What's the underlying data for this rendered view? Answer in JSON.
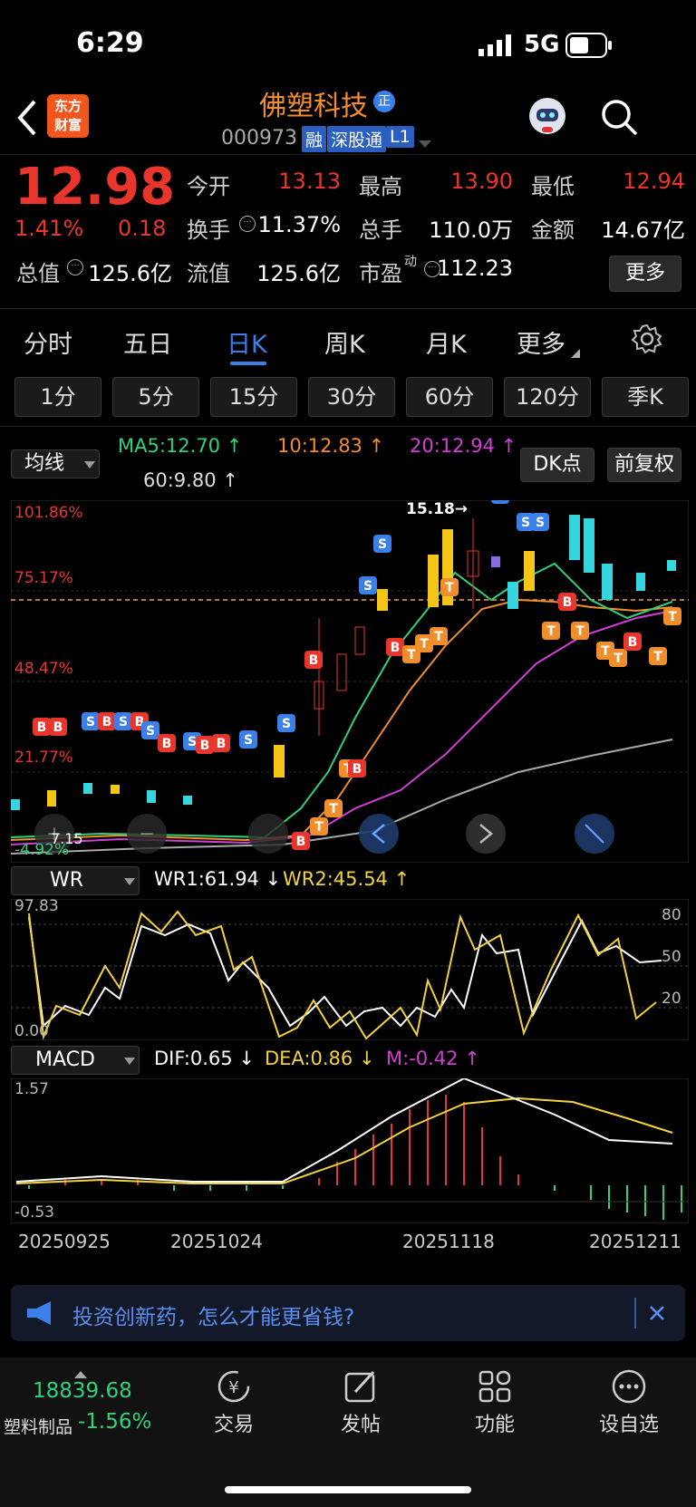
{
  "status_bar": {
    "time": "6:29",
    "network": "5G"
  },
  "header": {
    "stock_name": "佛塑科技",
    "badge": "正",
    "code": "000973",
    "tags": [
      "融",
      "深股通",
      "L1"
    ],
    "logo_text": "东方\n财富"
  },
  "quote": {
    "price": "12.98",
    "change_pct": "1.41%",
    "change": "0.18",
    "rows": [
      [
        {
          "label": "今开",
          "value": "13.13",
          "color": "red"
        },
        {
          "label": "最高",
          "value": "13.90",
          "color": "red"
        },
        {
          "label": "最低",
          "value": "12.94",
          "color": "red"
        }
      ],
      [
        {
          "label": "换手",
          "value": "11.37%",
          "color": "white"
        },
        {
          "label": "总手",
          "value": "110.0万",
          "color": "white"
        },
        {
          "label": "金额",
          "value": "14.67亿",
          "color": "white"
        }
      ]
    ],
    "total_value_label": "总值",
    "total_value": "125.6亿",
    "float_value_label": "流值",
    "float_value": "125.6亿",
    "pe_label": "市盈",
    "pe_sup": "动",
    "pe_value": "112.23",
    "more_label": "更多"
  },
  "period_tabs": [
    "分时",
    "五日",
    "日K",
    "周K",
    "月K",
    "更多"
  ],
  "active_period": "日K",
  "minute_buttons": [
    "1分",
    "5分",
    "15分",
    "30分",
    "60分",
    "120分",
    "季K"
  ],
  "ma": {
    "selector": "均线",
    "ma5": "MA5:12.70 ↑",
    "ma10": "10:12.83 ↑",
    "ma20": "20:12.94 ↑",
    "ma60": "60:9.80 ↑",
    "dk_label": "DK点",
    "adjust_label": "前复权"
  },
  "kline": {
    "y_labels": [
      "101.86%",
      "75.17%",
      "48.47%",
      "21.77%",
      "-4.92%"
    ],
    "high_annotation": "15.18→",
    "low_annotation": "7.15"
  },
  "wr": {
    "selector": "WR",
    "wr1": "WR1:61.94 ↓",
    "wr2": "WR2:45.54 ↑",
    "top": "97.83",
    "bottom": "0.00",
    "levels": [
      "80",
      "50",
      "20"
    ]
  },
  "macd": {
    "selector": "MACD",
    "dif": "DIF:0.65 ↓",
    "dea": "DEA:0.86 ↓",
    "m": "M:-0.42 ↑",
    "top": "1.57",
    "bottom": "-0.53"
  },
  "dates": [
    "20250925",
    "20251024",
    "20251118",
    "20251211"
  ],
  "banner": {
    "text": "投资创新药，怎么才能更省钱?"
  },
  "bottom_bar": {
    "index_value": "18839.68",
    "index_name": "塑料制品",
    "index_change": "-1.56%",
    "items": [
      {
        "label": "交易",
        "icon": "yen-cycle-icon"
      },
      {
        "label": "发帖",
        "icon": "edit-icon"
      },
      {
        "label": "功能",
        "icon": "grid-icon"
      },
      {
        "label": "设自选",
        "icon": "more-icon"
      }
    ]
  },
  "colors": {
    "up": "#e8362d",
    "down": "#2fd17a",
    "accent": "#3b7fe8",
    "candle_up": "#f5c518",
    "candle_down": "#36d6e0"
  }
}
